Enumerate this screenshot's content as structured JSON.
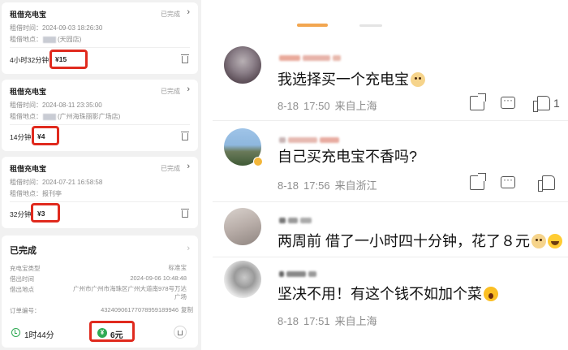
{
  "left": {
    "orders": [
      {
        "title": "租借充电宝",
        "status": "已完成",
        "time_label": "租借时间：",
        "time": "2024-09-03 18:26:30",
        "place_label": "租借地点：",
        "place": "(天园店)",
        "duration": "4小时32分钟",
        "price": "¥15"
      },
      {
        "title": "租借充电宝",
        "status": "已完成",
        "time_label": "租借时间：",
        "time": "2024-08-11 23:35:00",
        "place_label": "租借地点：",
        "place": "(广州海珠丽影广场店)",
        "duration": "14分钟",
        "price": "¥4"
      },
      {
        "title": "租借充电宝",
        "status": "已完成",
        "time_label": "租借时间：",
        "time": "2024-07-21 16:58:58",
        "place_label": "租借地点：",
        "place": "报刊亭",
        "duration": "32分钟",
        "price": "¥3"
      }
    ],
    "detail": {
      "title": "已完成",
      "rows": [
        {
          "label": "充电宝类型",
          "value": "标准宝"
        },
        {
          "label": "借出时间",
          "value": "2024-09-06 10:48:48"
        },
        {
          "label": "借出地点",
          "value": "广州市广州市海珠区广州大道南978号万达广场"
        },
        {
          "label": "订单编号：",
          "value": "43240906177078959189946"
        }
      ],
      "copy": "复制",
      "duration": "1时44分",
      "price": "6元",
      "yen_symbol": "¥"
    }
  },
  "right": {
    "comments": [
      {
        "text": "我选择买一个充电宝",
        "date": "8-18",
        "time": "17:50",
        "location": "来自上海",
        "likes": "1",
        "emoji": "dog"
      },
      {
        "text": "自己买充电宝不香吗?",
        "date": "8-18",
        "time": "17:56",
        "location": "来自浙江",
        "likes": "",
        "emoji": ""
      },
      {
        "text": "两周前 借了一小时四十分钟，花了８元",
        "date": "",
        "time": "",
        "location": "",
        "likes": "",
        "emoji": "dog,laugh"
      },
      {
        "text": "坚决不用！有这个钱不如加个菜",
        "date": "8-18",
        "time": "17:51",
        "location": "来自上海",
        "likes": "",
        "emoji": "scream"
      }
    ],
    "colors": {
      "accent": "#f2a650",
      "highlight": "#e02a1e",
      "green": "#2faa54"
    }
  }
}
